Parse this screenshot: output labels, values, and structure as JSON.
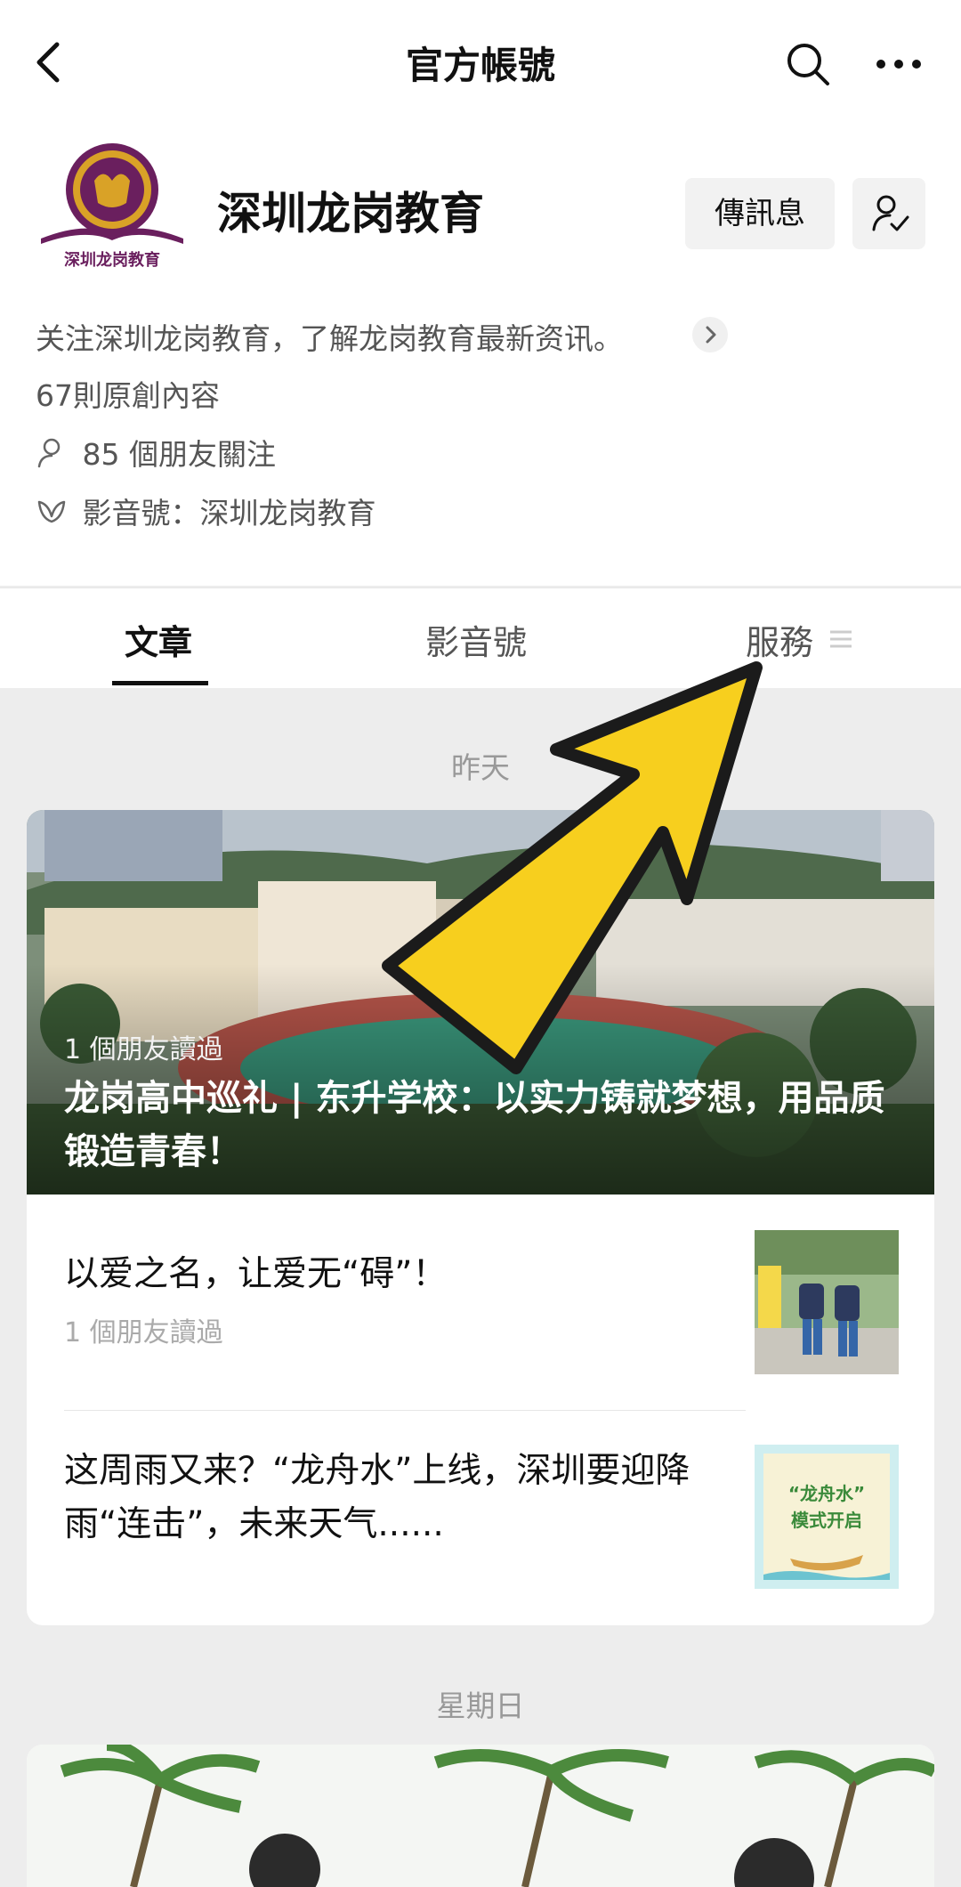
{
  "nav": {
    "title": "官方帳號",
    "back_icon": "chevron-left-icon",
    "search_icon": "search-icon",
    "more_icon": "more-horizontal-icon"
  },
  "profile": {
    "name": "深圳龙岗教育",
    "logo_text": "深圳龙岗教育",
    "message_button": "傳訊息",
    "description": "关注深圳龙岗教育，了解龙岗教育最新资讯。",
    "original_count": "67則原創內容",
    "friends_following": "85 個朋友關注",
    "channels": "影音號：深圳龙岗教育"
  },
  "tabs": [
    {
      "label": "文章",
      "active": true
    },
    {
      "label": "影音號",
      "active": false
    },
    {
      "label": "服務",
      "active": false
    }
  ],
  "feed": {
    "groups": [
      {
        "date": "昨天",
        "hero": {
          "readers": "1 個朋友讀過",
          "title": "龙岗高中巡礼 | 东升学校：以实力铸就梦想，用品质锻造青春！"
        },
        "articles": [
          {
            "title": "以爱之名，让爱无“碍”！",
            "readers": "1 個朋友讀過"
          },
          {
            "title": "这周雨又来？“龙舟水”上线，深圳要迎降雨“连击”，未来天气......",
            "readers": "",
            "thumb_text_1": "“龙舟水”",
            "thumb_text_2": "模式开启"
          }
        ]
      },
      {
        "date": "星期日"
      }
    ]
  },
  "colors": {
    "accent_arrow": "#F7CF1E",
    "tab_active": "#111111",
    "muted_text": "#999999"
  }
}
